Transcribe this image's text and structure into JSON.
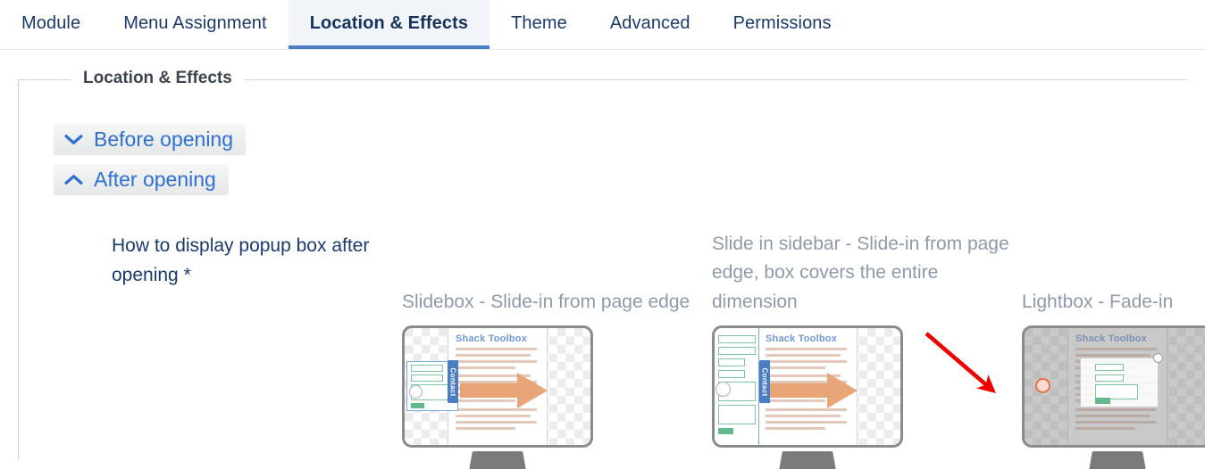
{
  "tabs": [
    {
      "label": "Module",
      "active": false
    },
    {
      "label": "Menu Assignment",
      "active": false
    },
    {
      "label": "Location & Effects",
      "active": true
    },
    {
      "label": "Theme",
      "active": false
    },
    {
      "label": "Advanced",
      "active": false
    },
    {
      "label": "Permissions",
      "active": false
    }
  ],
  "fieldset": {
    "legend": "Location & Effects"
  },
  "accordions": [
    {
      "label": "Before opening",
      "icon": "chevron-down-icon",
      "expanded": false
    },
    {
      "label": "After opening",
      "icon": "chevron-up-icon",
      "expanded": true
    }
  ],
  "field": {
    "label": "How to display popup box after opening *"
  },
  "options": [
    {
      "label": "Slidebox - Slide-in from page edge",
      "thumb_title": "Shack Toolbox",
      "thumb_tab": "Contact",
      "selected": false
    },
    {
      "label": "Slide in sidebar - Slide-in from page edge, box covers the entire dimension",
      "thumb_title": "Shack Toolbox",
      "thumb_tab": "Contact",
      "selected": false
    },
    {
      "label": "Lightbox - Fade-in",
      "thumb_title": "Shack Toolbox",
      "thumb_tab": "",
      "selected": true
    }
  ],
  "annotation": {
    "type": "arrow",
    "color": "#ee0000",
    "points_to": "lightbox-option-radio"
  },
  "colors": {
    "tab_active_underline": "#4a7dc4",
    "tab_text": "#1b3a6b",
    "accordion_link": "#2f6fd0",
    "option_label": "#8d9aab",
    "fieldset_border": "#c3d3e3",
    "annotation_red": "#ee0000",
    "radio_orange": "#e8714a"
  }
}
